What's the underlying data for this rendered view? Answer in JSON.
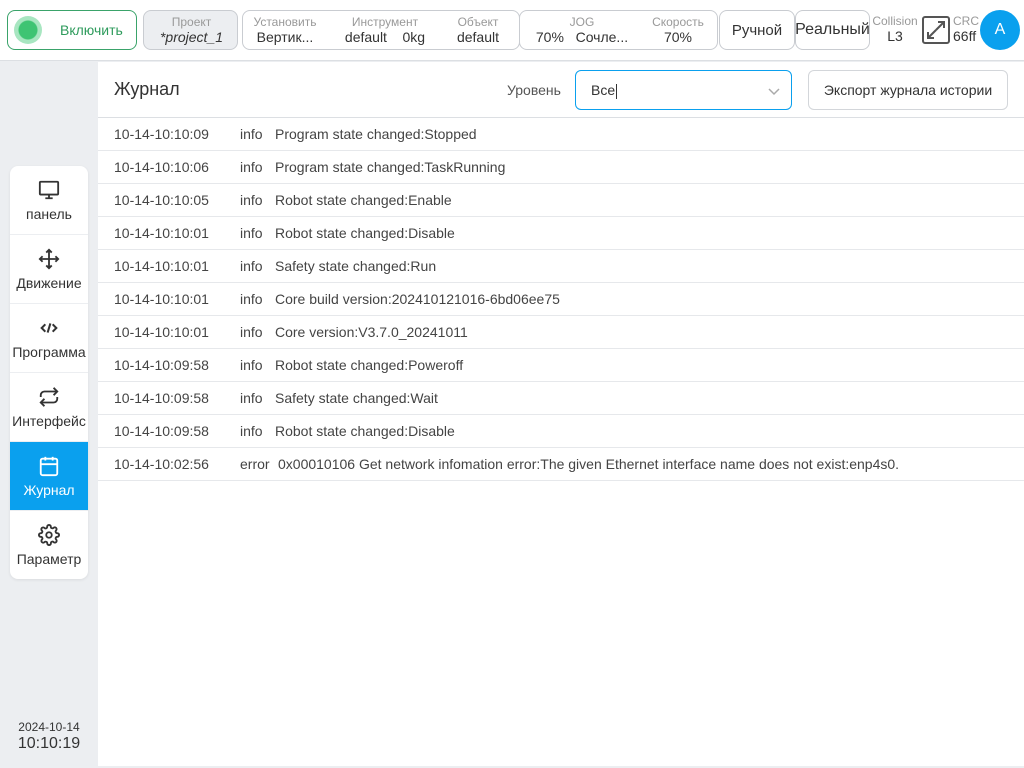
{
  "topbar": {
    "enable_label": "Включить",
    "project": {
      "label": "Проект",
      "value": "*project_1"
    },
    "install": {
      "label": "Установить",
      "value": "Вертик..."
    },
    "tool": {
      "label": "Инструмент",
      "value": "default",
      "payload": "0kg"
    },
    "object": {
      "label": "Объект",
      "value": "default"
    },
    "jog": {
      "label": "JOG",
      "value": "70%",
      "mode": "Сочле..."
    },
    "speed": {
      "label": "Скорость",
      "value": "70%"
    },
    "manual_label": "Ручной",
    "real_label": "Реальный",
    "collision": {
      "label": "Collision",
      "value": "L3"
    },
    "crc": {
      "label": "CRC",
      "value": "66ff"
    },
    "avatar_letter": "A"
  },
  "sidebar": {
    "items": [
      {
        "label": "панель",
        "icon": "monitor-icon"
      },
      {
        "label": "Движение",
        "icon": "move-icon"
      },
      {
        "label": "Программа",
        "icon": "code-icon"
      },
      {
        "label": "Интерфейс",
        "icon": "swap-icon"
      },
      {
        "label": "Журнал",
        "icon": "calendar-icon",
        "active": true
      },
      {
        "label": "Параметр",
        "icon": "gear-icon"
      }
    ]
  },
  "clock": {
    "date": "2024-10-14",
    "time": "10:10:19"
  },
  "main": {
    "title": "Журнал",
    "level_label": "Уровень",
    "level_value": "Все",
    "export_label": "Экспорт журнала истории"
  },
  "log": [
    {
      "time": "10-14-10:10:09",
      "level": "info",
      "message": "Program state changed:Stopped"
    },
    {
      "time": "10-14-10:10:06",
      "level": "info",
      "message": "Program state changed:TaskRunning"
    },
    {
      "time": "10-14-10:10:05",
      "level": "info",
      "message": "Robot state changed:Enable"
    },
    {
      "time": "10-14-10:10:01",
      "level": "info",
      "message": "Robot state changed:Disable"
    },
    {
      "time": "10-14-10:10:01",
      "level": "info",
      "message": "Safety state changed:Run"
    },
    {
      "time": "10-14-10:10:01",
      "level": "info",
      "message": "Core build version:202410121016-6bd06ee75"
    },
    {
      "time": "10-14-10:10:01",
      "level": "info",
      "message": "Core version:V3.7.0_20241011"
    },
    {
      "time": "10-14-10:09:58",
      "level": "info",
      "message": "Robot state changed:Poweroff"
    },
    {
      "time": "10-14-10:09:58",
      "level": "info",
      "message": "Safety state changed:Wait"
    },
    {
      "time": "10-14-10:09:58",
      "level": "info",
      "message": "Robot state changed:Disable"
    },
    {
      "time": "10-14-10:02:56",
      "level": "error",
      "message": "0x00010106 Get network infomation error:The given Ethernet interface name does not exist:enp4s0."
    }
  ],
  "colors": {
    "accent": "#0aa0ee",
    "enable_green": "#3ec473"
  }
}
